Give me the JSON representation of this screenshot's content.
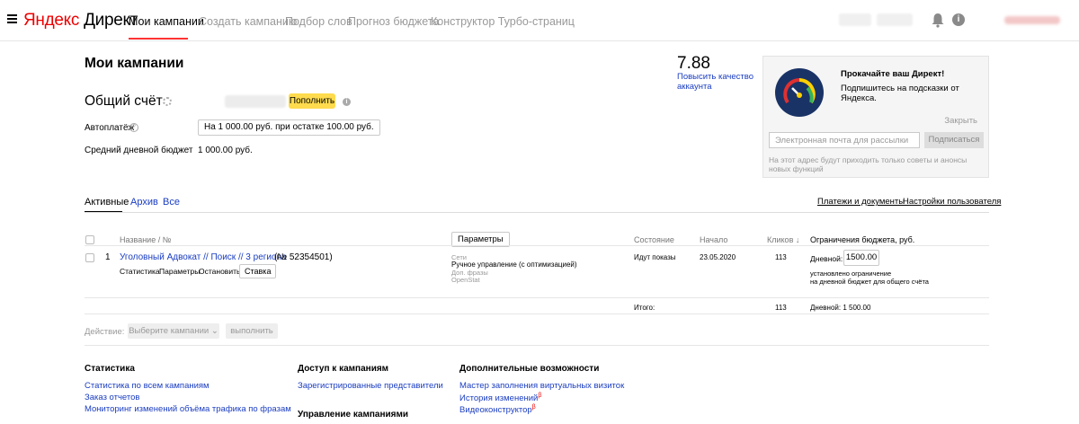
{
  "header": {
    "logo_yandex": "Яндекс",
    "logo_direct": "Директ",
    "nav": [
      "Мои кампании",
      "Создать кампанию",
      "Подбор слов",
      "Прогноз бюджета",
      "Конструктор Турбо-страниц"
    ],
    "info_label": "i"
  },
  "page": {
    "title": "Мои кампании",
    "account_title": "Общий счёт",
    "topup_label": "Пополнить",
    "autopay_label": "Автоплатёж",
    "autopay_value": "На 1 000.00 руб. при остатке 100.00 руб.",
    "daily_budget_label": "Средний дневной бюджет",
    "daily_budget_value": "1 000.00 руб."
  },
  "quality": {
    "score": "7.88",
    "link_line1": "Повысить качество",
    "link_line2": "аккаунта"
  },
  "promo": {
    "title": "Прокачайте ваш Директ!",
    "text": "Подпишитесь на подсказки от Яндекса.",
    "close": "Закрыть",
    "email_placeholder": "Электронная почта для рассылки",
    "subscribe": "Подписаться",
    "note": "На этот адрес будут приходить только советы и анонсы новых функций"
  },
  "tabs": {
    "active": "Активные",
    "archive": "Архив",
    "all": "Все",
    "payments": "Платежи и документы",
    "settings": "Настройки пользователя"
  },
  "table": {
    "headers": {
      "name": "Название / №",
      "params": "Параметры",
      "state": "Состояние",
      "start": "Начало",
      "clicks": "Кликов ↓",
      "budget": "Ограничения бюджета, руб."
    },
    "row": {
      "index": "1",
      "name": "Уголовный Адвокат // Поиск // 3 региона",
      "number": "(№ 52354501)",
      "actions": [
        "Статистика",
        "Параметры",
        "Остановить"
      ],
      "bid_button": "Ставка",
      "net_label": "Сети",
      "strategy": "Ручное управление (с оптимизацией)",
      "extra1": "Доп. фразы",
      "extra2": "OpenStat",
      "state": "Идут показы",
      "start": "23.05.2020",
      "clicks": "113",
      "daily_label": "Дневной:",
      "daily_value": "1500.00",
      "limit_note1": "установлено ограничение",
      "limit_note2": "на дневной бюджет для общего счёта"
    },
    "total": {
      "label": "Итого:",
      "clicks": "113",
      "daily": "Дневной: 1 500.00"
    }
  },
  "actions_bar": {
    "label": "Действие:",
    "select": "Выберите кампании",
    "execute": "выполнить"
  },
  "footer": {
    "stats_title": "Статистика",
    "stats_links": [
      "Статистика по всем кампаниям",
      "Заказ отчетов",
      "Мониторинг изменений объёма трафика по фразам"
    ],
    "access_title": "Доступ к кампаниям",
    "access_links": [
      "Зарегистрированные представители"
    ],
    "manage_title": "Управление кампаниями",
    "extra_title": "Дополнительные возможности",
    "extra_links": [
      "Мастер заполнения виртуальных визиток",
      "История изменений",
      "Видеоконструктор"
    ],
    "beta_mark": "β"
  },
  "colors": {
    "accent_red": "#ff3333",
    "link_blue": "#1a3dc1",
    "yellow_button": "#ffdb4d"
  }
}
